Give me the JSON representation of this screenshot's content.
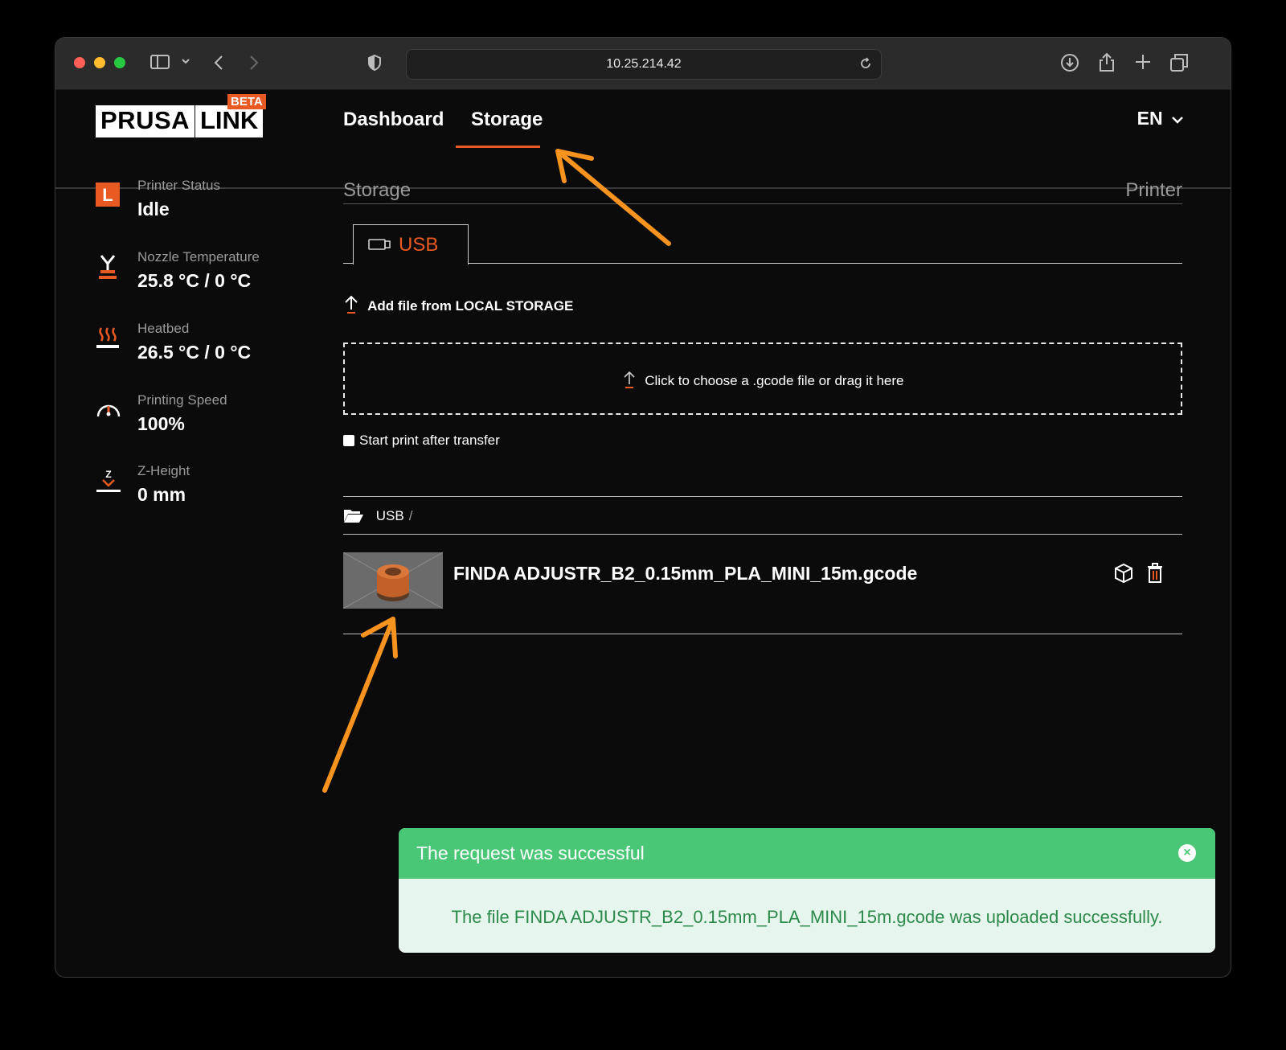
{
  "browser": {
    "url": "10.25.214.42"
  },
  "header": {
    "logo_left": "PRUSA",
    "logo_right": "LINK",
    "logo_badge": "BETA",
    "nav": [
      "Dashboard",
      "Storage"
    ],
    "active_nav": "Storage",
    "language": "EN"
  },
  "sidebar": {
    "items": [
      {
        "label": "Printer Status",
        "value": "Idle",
        "icon": "printer-status-icon"
      },
      {
        "label": "Nozzle Temperature",
        "value": "25.8 °C / 0 °C",
        "icon": "nozzle-icon"
      },
      {
        "label": "Heatbed",
        "value": "26.5 °C / 0 °C",
        "icon": "heatbed-icon"
      },
      {
        "label": "Printing Speed",
        "value": "100%",
        "icon": "speedometer-icon"
      },
      {
        "label": "Z-Height",
        "value": "0 mm",
        "icon": "z-height-icon"
      }
    ]
  },
  "main": {
    "section_left": "Storage",
    "section_right": "Printer",
    "storage_tab": "USB",
    "add_file": "Add file from LOCAL STORAGE",
    "dropzone_text": "Click to choose a .gcode file or drag it here",
    "start_print_label": "Start print after transfer",
    "start_print_checked": false,
    "breadcrumb": [
      "USB"
    ],
    "files": [
      {
        "name": "FINDA ADJUSTR_B2_0.15mm_PLA_MINI_15m.gcode"
      }
    ]
  },
  "toast": {
    "title": "The request was successful",
    "message": "The file FINDA ADJUSTR_B2_0.15mm_PLA_MINI_15m.gcode was uploaded successfully.",
    "color": "#4ac776"
  },
  "colors": {
    "accent": "#e95a22",
    "background": "#0b0b0b",
    "annotation_arrow": "#f7931e"
  }
}
